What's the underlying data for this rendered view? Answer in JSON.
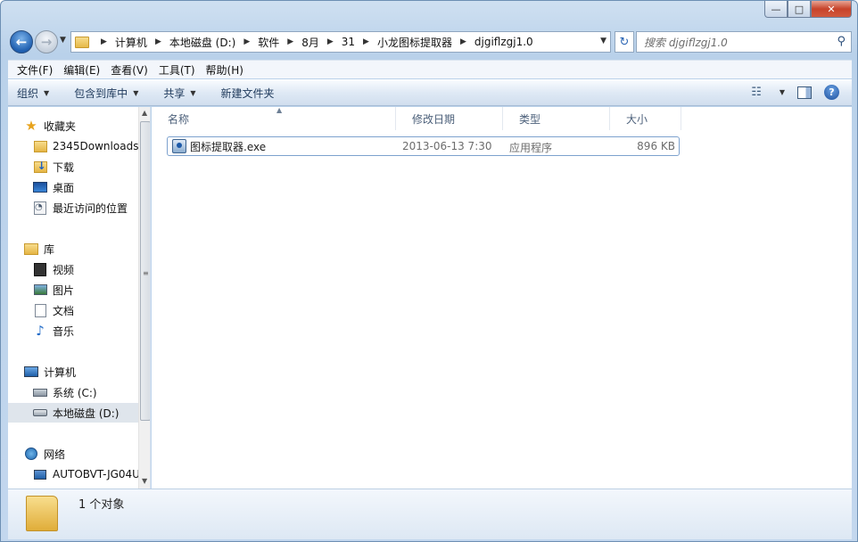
{
  "window": {
    "title_buttons": {
      "minimize": "—",
      "maximize": "□",
      "close": "✕"
    }
  },
  "address": {
    "back_glyph": "←",
    "forward_glyph": "→",
    "breadcrumbs": [
      "计算机",
      "本地磁盘 (D:)",
      "软件",
      "8月",
      "31",
      "小龙图标提取器",
      "djgiflzgj1.0"
    ],
    "refresh_glyph": "↻",
    "search_placeholder": "搜索 djgiflzgj1.0"
  },
  "menubar": [
    "文件(F)",
    "编辑(E)",
    "查看(V)",
    "工具(T)",
    "帮助(H)"
  ],
  "toolbar": {
    "organize": "组织",
    "include_in_library": "包含到库中",
    "share": "共享",
    "new_folder": "新建文件夹",
    "help_glyph": "?"
  },
  "navpane": {
    "favorites": {
      "label": "收藏夹",
      "items": [
        "2345Downloads",
        "下载",
        "桌面",
        "最近访问的位置"
      ]
    },
    "libraries": {
      "label": "库",
      "items": [
        "视频",
        "图片",
        "文档",
        "音乐"
      ]
    },
    "computer": {
      "label": "计算机",
      "items": [
        "系统 (C:)",
        "本地磁盘 (D:)"
      ],
      "selected": "本地磁盘 (D:)"
    },
    "network": {
      "label": "网络",
      "items": [
        "AUTOBVT-JG04U"
      ]
    }
  },
  "columns": [
    "名称",
    "修改日期",
    "类型",
    "大小"
  ],
  "files": [
    {
      "name": "图标提取器.exe",
      "modified": "2013-06-13 7:30",
      "type": "应用程序",
      "size": "896 KB"
    }
  ],
  "status": {
    "count_text": "1 个对象"
  },
  "colors": {
    "accent": "#1f5fb0",
    "selection": "#dfe5ec",
    "border": "#7da2ce"
  }
}
